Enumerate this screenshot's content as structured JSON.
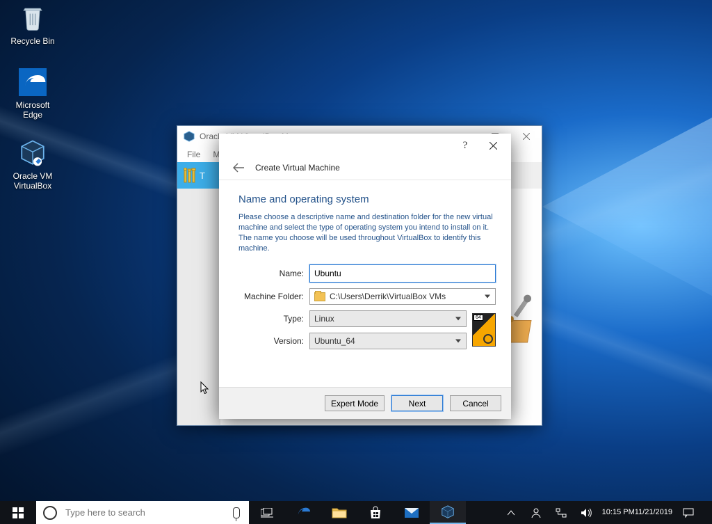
{
  "desktop": {
    "icons": [
      {
        "name": "recycle-bin",
        "label": "Recycle Bin"
      },
      {
        "name": "microsoft-edge",
        "label": "Microsoft\nEdge"
      },
      {
        "name": "oracle-vm-virtualbox",
        "label": "Oracle VM\nVirtualBox"
      }
    ]
  },
  "vbox_window": {
    "title": "Oracle VM VirtualBox Manager",
    "menu": {
      "file": "File",
      "machine_trunc": "Ma"
    },
    "tools_label": "T"
  },
  "wizard": {
    "header_title": "Create Virtual Machine",
    "section_title": "Name and operating system",
    "description": "Please choose a descriptive name and destination folder for the new virtual machine and select the type of operating system you intend to install on it. The name you choose will be used throughout VirtualBox to identify this machine.",
    "fields": {
      "name_label": "Name:",
      "name_value": "Ubuntu",
      "folder_label": "Machine Folder:",
      "folder_value": "C:\\Users\\Derrik\\VirtualBox VMs",
      "type_label": "Type:",
      "type_value": "Linux",
      "version_label": "Version:",
      "version_value": "Ubuntu_64"
    },
    "buttons": {
      "expert": "Expert Mode",
      "next": "Next",
      "cancel": "Cancel"
    }
  },
  "taskbar": {
    "search_placeholder": "Type here to search",
    "clock": {
      "time": "10:15 PM",
      "date": "11/21/2019"
    }
  }
}
